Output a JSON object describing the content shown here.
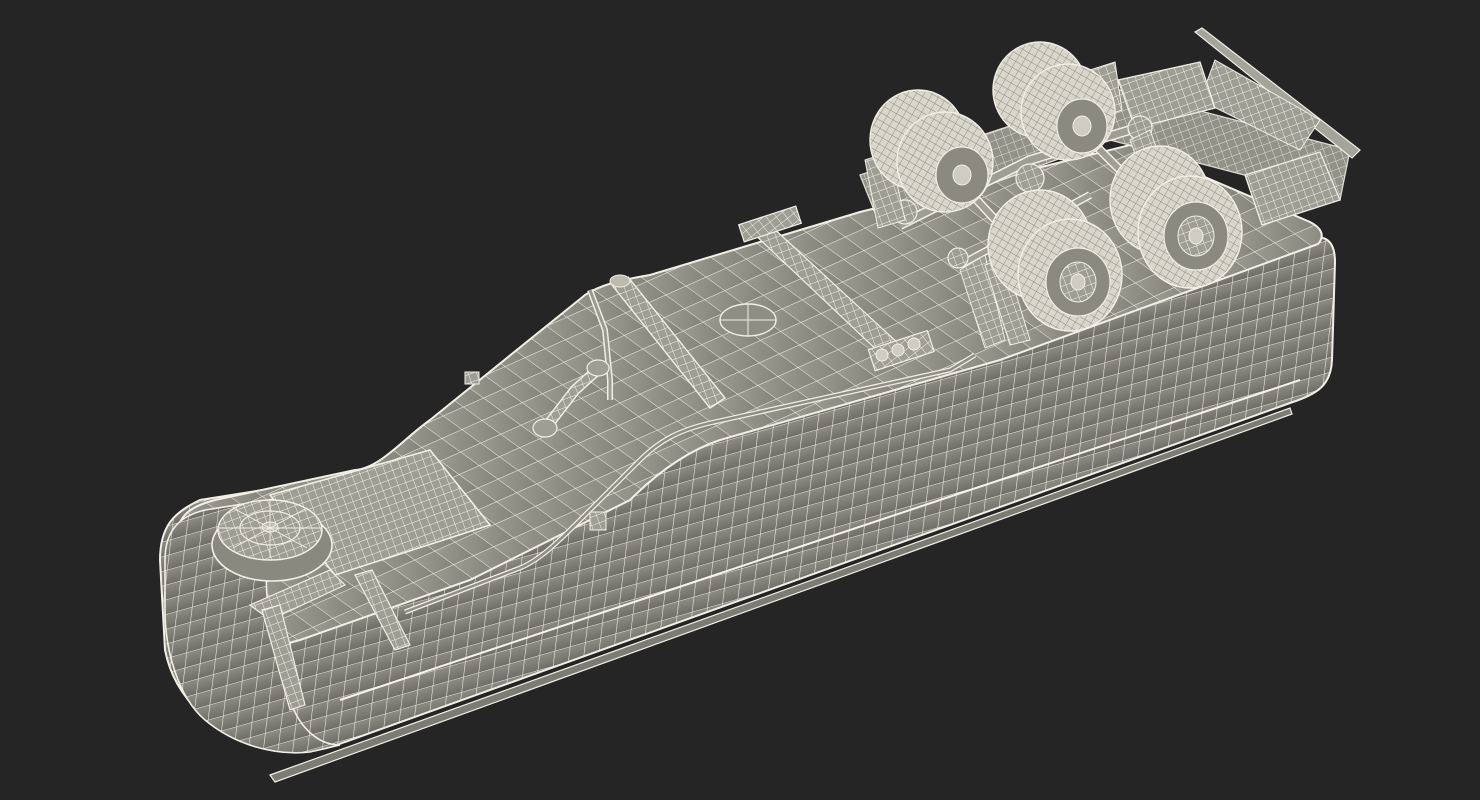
{
  "scene": {
    "subject": "trailer-wireframe-render",
    "background_color": "#252525",
    "surface_color": "#8f8e85",
    "surface_dark": "#74736b",
    "surface_light": "#a5a49a",
    "wire_color": "#f1efe6",
    "wheel_count": 8,
    "axle_count": 2
  }
}
